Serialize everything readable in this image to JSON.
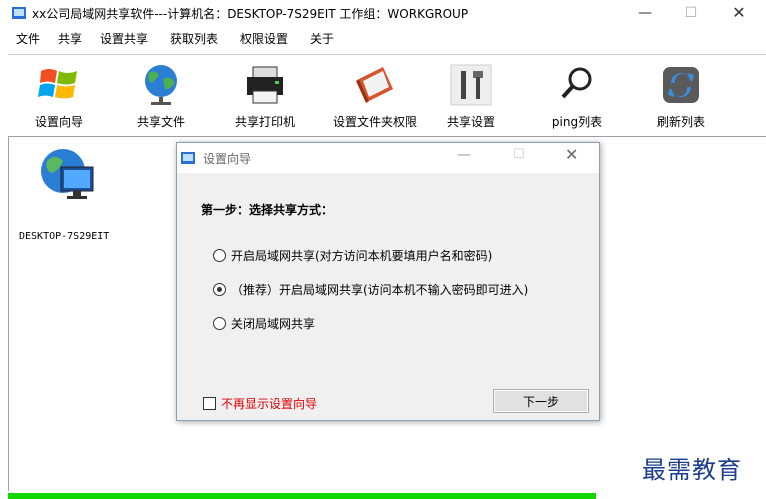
{
  "window": {
    "title": "xx公司局域网共享软件---计算机名：DESKTOP-7S29EIT  工作组：WORKGROUP",
    "min_glyph": "—",
    "max_glyph": "☐",
    "close_glyph": "✕"
  },
  "menu": [
    "文件",
    "共享",
    "设置共享",
    "获取列表",
    "权限设置",
    "关于"
  ],
  "toolbar": [
    {
      "label": "设置向导",
      "icon": "windows-logo-icon"
    },
    {
      "label": "共享文件",
      "icon": "globe-icon"
    },
    {
      "label": "共享打印机",
      "icon": "printer-icon"
    },
    {
      "label": "设置文件夹权限",
      "icon": "folder-edit-icon"
    },
    {
      "label": "共享设置",
      "icon": "tools-icon"
    },
    {
      "label": "ping列表",
      "icon": "magnifier-icon"
    },
    {
      "label": "刷新列表",
      "icon": "refresh-icon"
    }
  ],
  "computers": [
    {
      "name": "DESKTOP-7S29EIT",
      "icon": "network-computer-icon"
    }
  ],
  "dialog": {
    "title": "设置向导",
    "min_glyph": "—",
    "max_glyph": "☐",
    "close_glyph": "✕",
    "step": "第一步：选择共享方式：",
    "options": [
      {
        "label": "开启局域网共享(对方访问本机要填用户名和密码)",
        "checked": false
      },
      {
        "label": "（推荐）开启局域网共享(访问本机不输入密码即可进入)",
        "checked": true
      },
      {
        "label": "关闭局域网共享",
        "checked": false
      }
    ],
    "dont_show": "不再显示设置向导",
    "next_button": "下一步"
  },
  "status": {
    "progress_fraction": 1.0,
    "text": "",
    "progress_color": "#12d600"
  },
  "watermark": "最需教育"
}
